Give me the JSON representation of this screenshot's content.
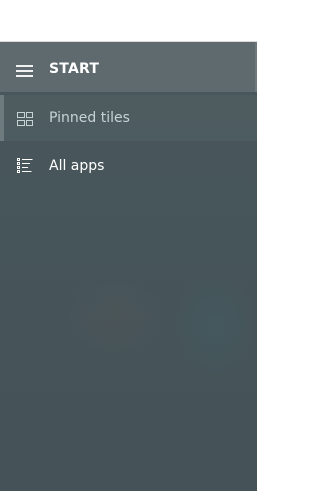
{
  "header": {
    "title": "START",
    "menu_icon": "hamburger-menu-icon"
  },
  "nav": {
    "items": [
      {
        "label": "Pinned tiles",
        "icon": "tiles-icon",
        "selected": true
      },
      {
        "label": "All apps",
        "icon": "app-list-icon",
        "selected": false
      }
    ]
  },
  "colors": {
    "panel_background": "#4a585c",
    "header_background": "#5e6a6e",
    "selected_text": "#c7d2d4",
    "text": "#ffffff"
  }
}
